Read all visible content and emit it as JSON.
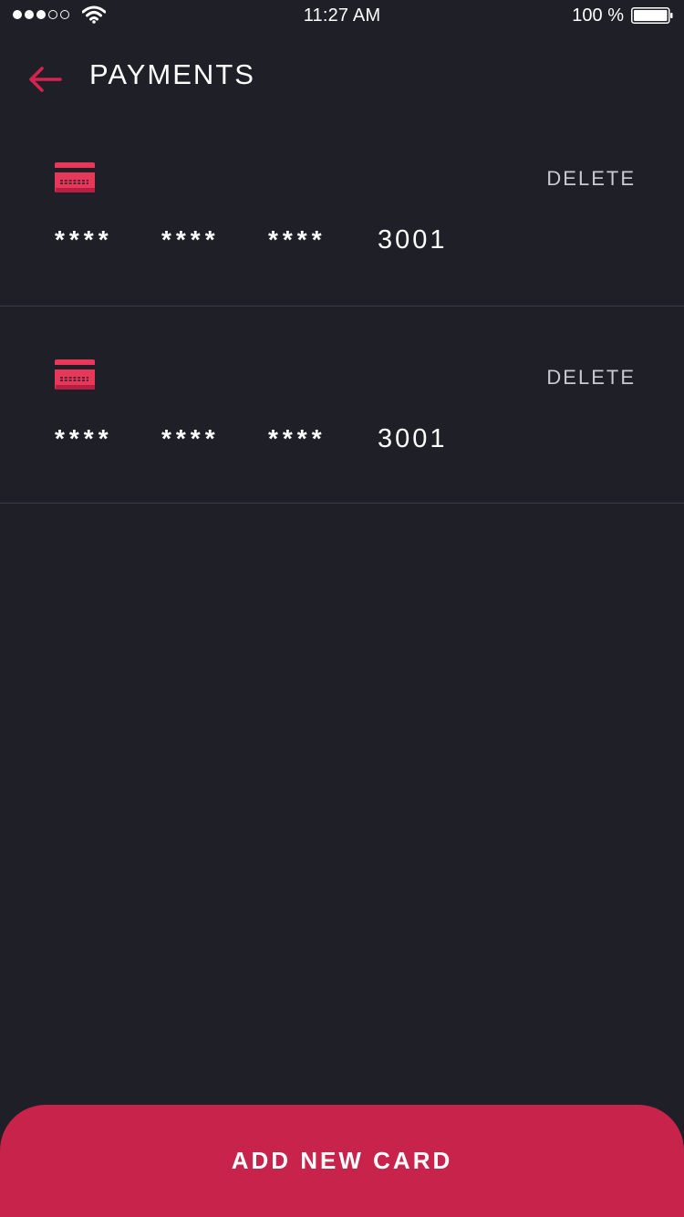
{
  "status_bar": {
    "time": "11:27 AM",
    "battery_percent": "100 %",
    "signal_bars_filled": 3,
    "signal_bars_total": 5,
    "battery_level": 1.0
  },
  "header": {
    "title": "PAYMENTS",
    "back_icon": "arrow-left-icon"
  },
  "cards": [
    {
      "icon": "credit-card-icon",
      "delete_label": "DELETE",
      "masked_groups": [
        "****",
        "****",
        "****"
      ],
      "last_four": "3001"
    },
    {
      "icon": "credit-card-icon",
      "delete_label": "DELETE",
      "masked_groups": [
        "****",
        "****",
        "****"
      ],
      "last_four": "3001"
    }
  ],
  "footer": {
    "add_card_label": "ADD NEW CARD"
  },
  "colors": {
    "background": "#1f1f28",
    "accent": "#c8234a",
    "card_icon": "#e8385a",
    "divider": "#3a3a44"
  }
}
